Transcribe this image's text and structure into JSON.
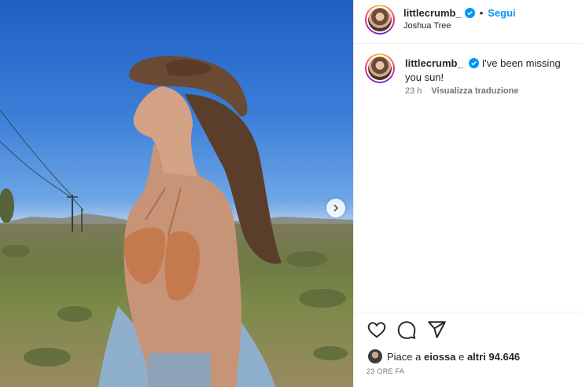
{
  "post": {
    "username": "littlecrumb_",
    "follow_label": "Segui",
    "separator": "•",
    "location": "Joshua Tree",
    "caption_text": "I've been missing you sun!",
    "time_ago": "23 h",
    "translate_label": "Visualizza traduzione",
    "likes_prefix": "Piace a ",
    "likes_user": "eiossa",
    "likes_middle": " e ",
    "likes_count": "altri 94.646",
    "timestamp": "23 ORE FA"
  },
  "icons": {
    "verified": "verified-badge-icon",
    "next": "chevron-right-icon",
    "like": "heart-icon",
    "comment": "comment-icon",
    "share": "paper-plane-icon"
  },
  "colors": {
    "follow": "#0095f6",
    "verified": "#0095f6",
    "text": "#262626",
    "muted": "#737373"
  }
}
